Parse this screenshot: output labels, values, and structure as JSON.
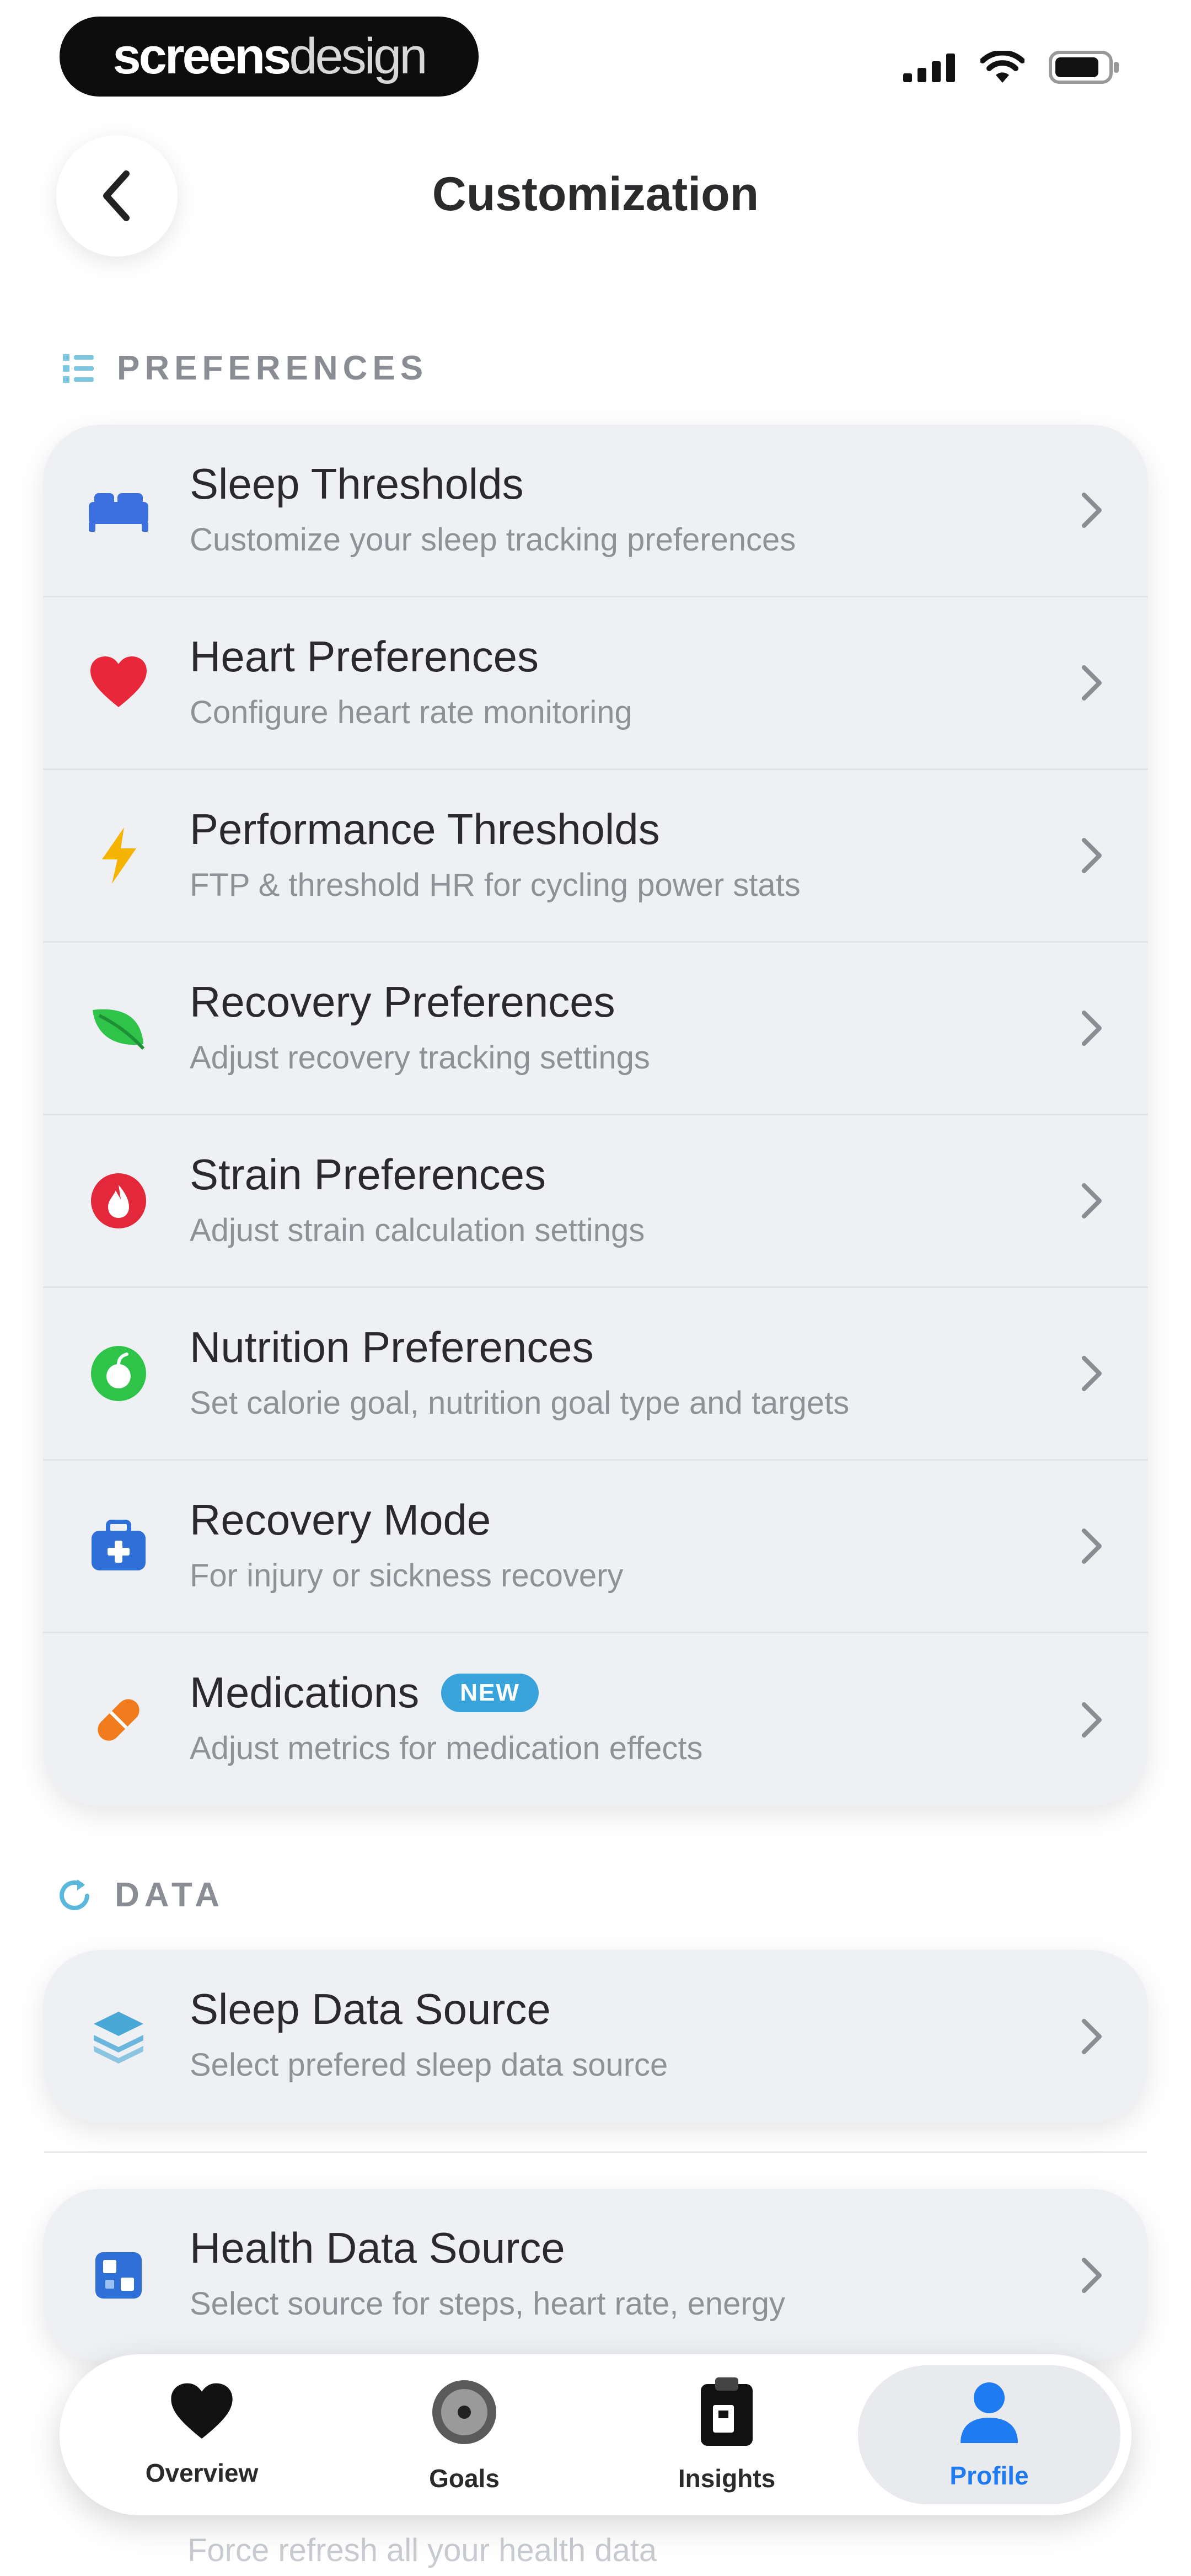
{
  "status_bar": {
    "brand_part1": "screens",
    "brand_part2": "design",
    "icons": [
      "signal-icon",
      "wifi-icon",
      "battery-icon"
    ]
  },
  "header": {
    "title": "Customization",
    "back_icon": "chevron-left-icon"
  },
  "sections": [
    {
      "label": "PREFERENCES",
      "icon": "list-icon",
      "items": [
        {
          "title": "Sleep Thresholds",
          "subtitle": "Customize your sleep tracking preferences",
          "icon": "bed-icon",
          "color": "#3b6fe0"
        },
        {
          "title": "Heart Preferences",
          "subtitle": "Configure heart rate monitoring",
          "icon": "heart-icon",
          "color": "#e8283a"
        },
        {
          "title": "Performance Thresholds",
          "subtitle": "FTP & threshold HR for cycling power stats",
          "icon": "bolt-icon",
          "color": "#f4b400"
        },
        {
          "title": "Recovery Preferences",
          "subtitle": "Adjust recovery tracking settings",
          "icon": "leaf-icon",
          "color": "#2fc34a"
        },
        {
          "title": "Strain Preferences",
          "subtitle": "Adjust strain calculation settings",
          "icon": "flame-icon",
          "color": "#e2283a"
        },
        {
          "title": "Nutrition Preferences",
          "subtitle": "Set calorie goal, nutrition goal type and targets",
          "icon": "nutrition-icon",
          "color": "#2fc34a"
        },
        {
          "title": "Recovery Mode",
          "subtitle": "For injury or sickness recovery",
          "icon": "medkit-icon",
          "color": "#2f6fd8"
        },
        {
          "title": "Medications",
          "subtitle": "Adjust metrics for medication effects",
          "icon": "pill-icon",
          "color": "#f07c1e",
          "badge": "NEW"
        }
      ]
    },
    {
      "label": "DATA",
      "icon": "refresh-icon",
      "items": [
        {
          "title": "Sleep Data Source",
          "subtitle": "Select prefered sleep data source",
          "icon": "layers-icon",
          "color": "#4aa8d6"
        }
      ]
    },
    {
      "label": "",
      "items": [
        {
          "title": "Health Data Source",
          "subtitle": "Select source for steps, heart rate, energy",
          "icon": "health-data-icon",
          "color": "#2f6fd8"
        }
      ]
    }
  ],
  "partial_row_subtitle": "Force refresh all your health data",
  "tabs": [
    {
      "label": "Overview",
      "icon": "heart-icon",
      "active": false
    },
    {
      "label": "Goals",
      "icon": "target-icon",
      "active": false
    },
    {
      "label": "Insights",
      "icon": "clipboard-icon",
      "active": false
    },
    {
      "label": "Profile",
      "icon": "person-icon",
      "active": true
    }
  ],
  "colors": {
    "accent": "#1e7bf2",
    "card_background": "#eef0f3",
    "badge": "#39a3dc"
  }
}
